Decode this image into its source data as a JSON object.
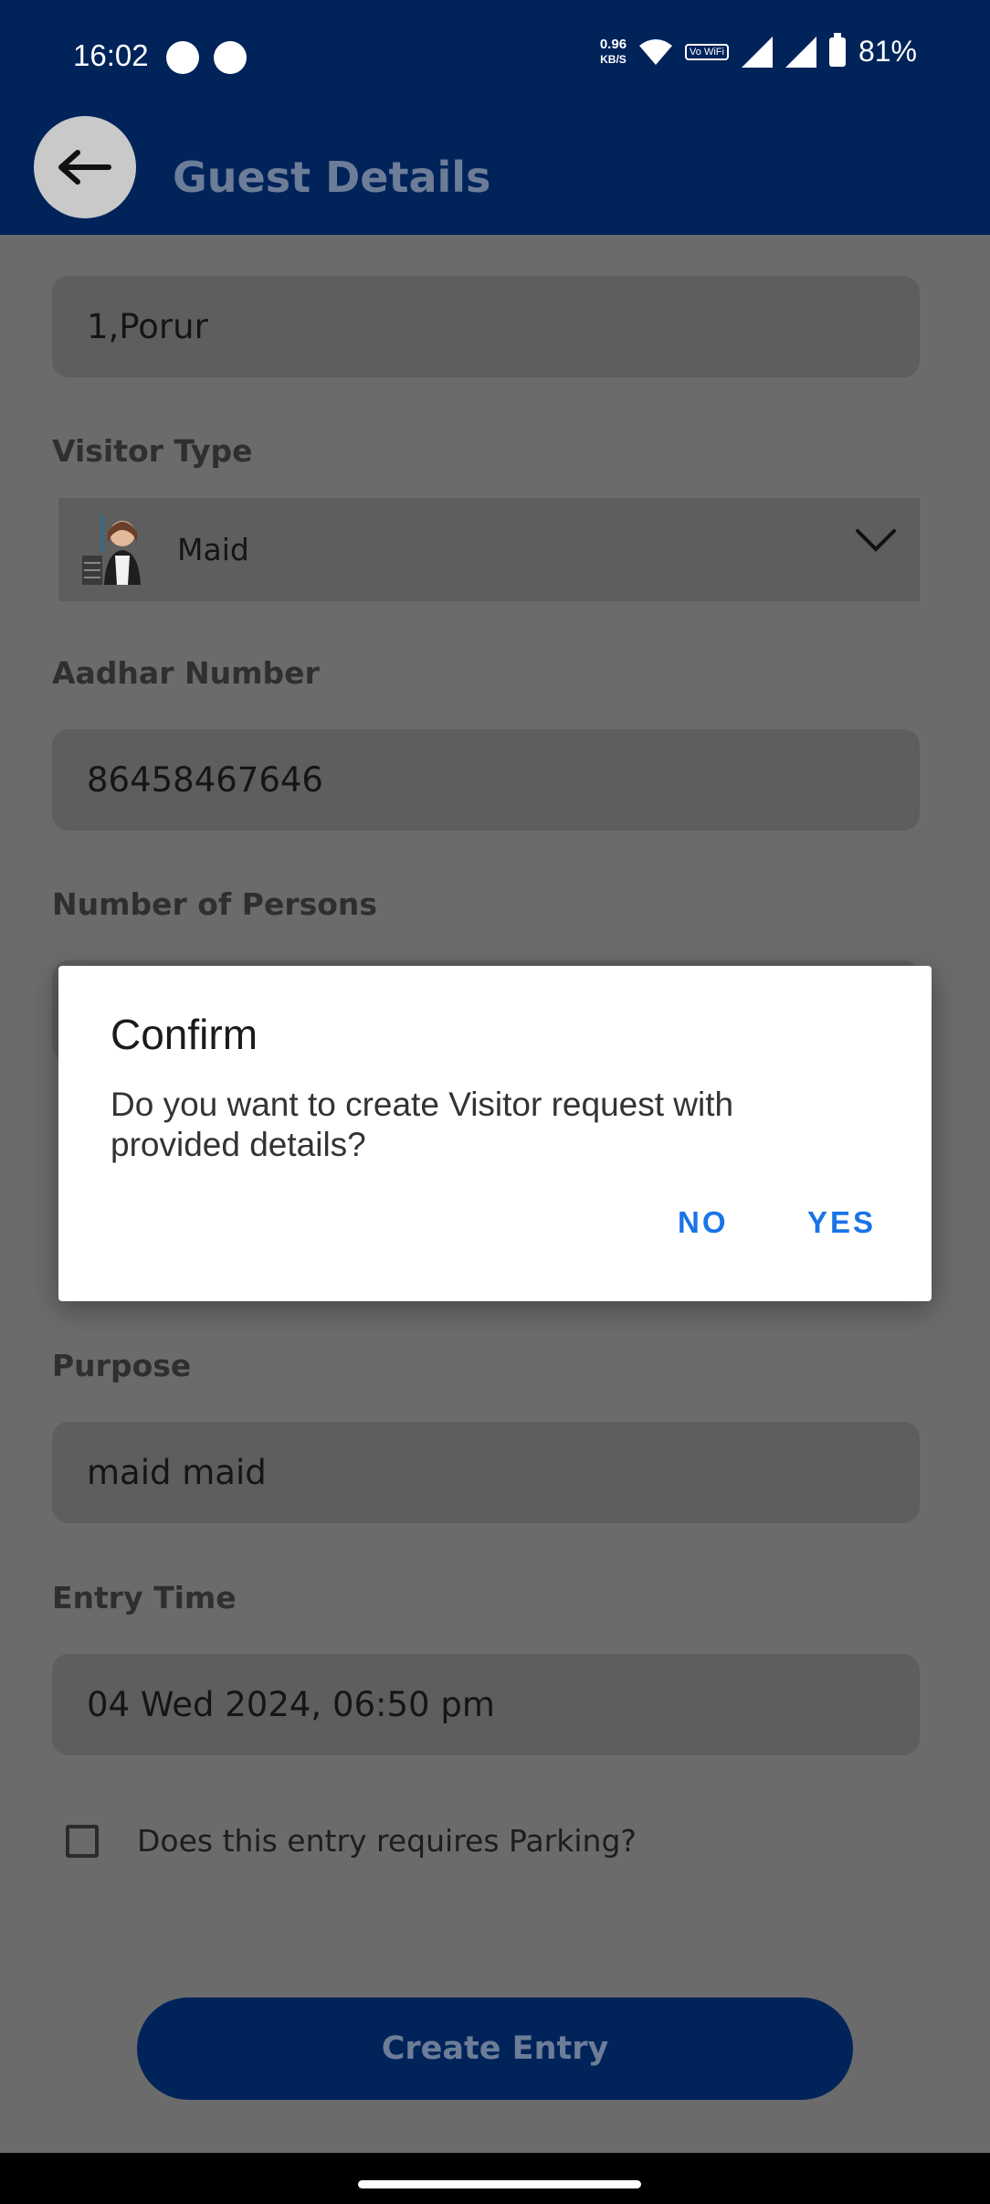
{
  "status_bar": {
    "time": "16:02",
    "net_speed_value": "0.96",
    "net_speed_unit": "KB/S",
    "wifi_badge": "Vo WiFi",
    "battery": "81%"
  },
  "app_bar": {
    "title": "Guest Details",
    "back_icon": "arrow-left-icon"
  },
  "form": {
    "address_value": "1,Porur",
    "visitor_type_label": "Visitor Type",
    "visitor_type_value": "Maid",
    "aadhar_label": "Aadhar Number",
    "aadhar_value": "86458467646",
    "persons_label": "Number of Persons",
    "purpose_label": "Purpose",
    "purpose_value": "maid maid",
    "entry_time_label": "Entry Time",
    "entry_time_value": "04 Wed 2024, 06:50 pm",
    "parking_label": "Does this entry requires Parking?",
    "parking_checked": false,
    "submit_label": "Create Entry"
  },
  "dialog": {
    "title": "Confirm",
    "message": "Do you want to create Visitor request with provided details?",
    "no_label": "NO",
    "yes_label": "YES"
  },
  "colors": {
    "app_bar": "#00235a",
    "accent_button_text": "#1a73e8",
    "scrim_background": "#6b6b6b"
  }
}
